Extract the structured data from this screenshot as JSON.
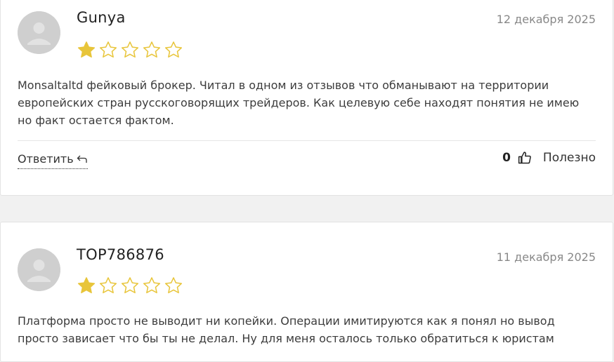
{
  "reviews": [
    {
      "author": "Gunya",
      "date": "12 декабря 2025",
      "rating": 1,
      "max_rating": 5,
      "text": "Monsaltaltd фейковый брокер. Читал в одном из отзывов что обманывают на территории европейских стран русскоговорящих трейдеров. Как целевую себе находят понятия не имею но факт остается фактом.",
      "reply_label": "Ответить",
      "votes": "0",
      "useful_label": "Полезно"
    },
    {
      "author": "TOP786876",
      "date": "11 декабря 2025",
      "rating": 1,
      "max_rating": 5,
      "text": "Платформа просто не выводит ни копейки. Операции имитируются как я понял но вывод просто зависает что бы ты не делал. Ну для меня осталось только обратиться к юристам"
    }
  ],
  "colors": {
    "star_filled": "#e8c53a",
    "star_empty_stroke": "#e8c53a",
    "avatar_bg": "#cfcfcf"
  },
  "icons": [
    "avatar-placeholder-icon",
    "star-icon",
    "reply-arrow-icon",
    "thumbs-up-icon"
  ]
}
